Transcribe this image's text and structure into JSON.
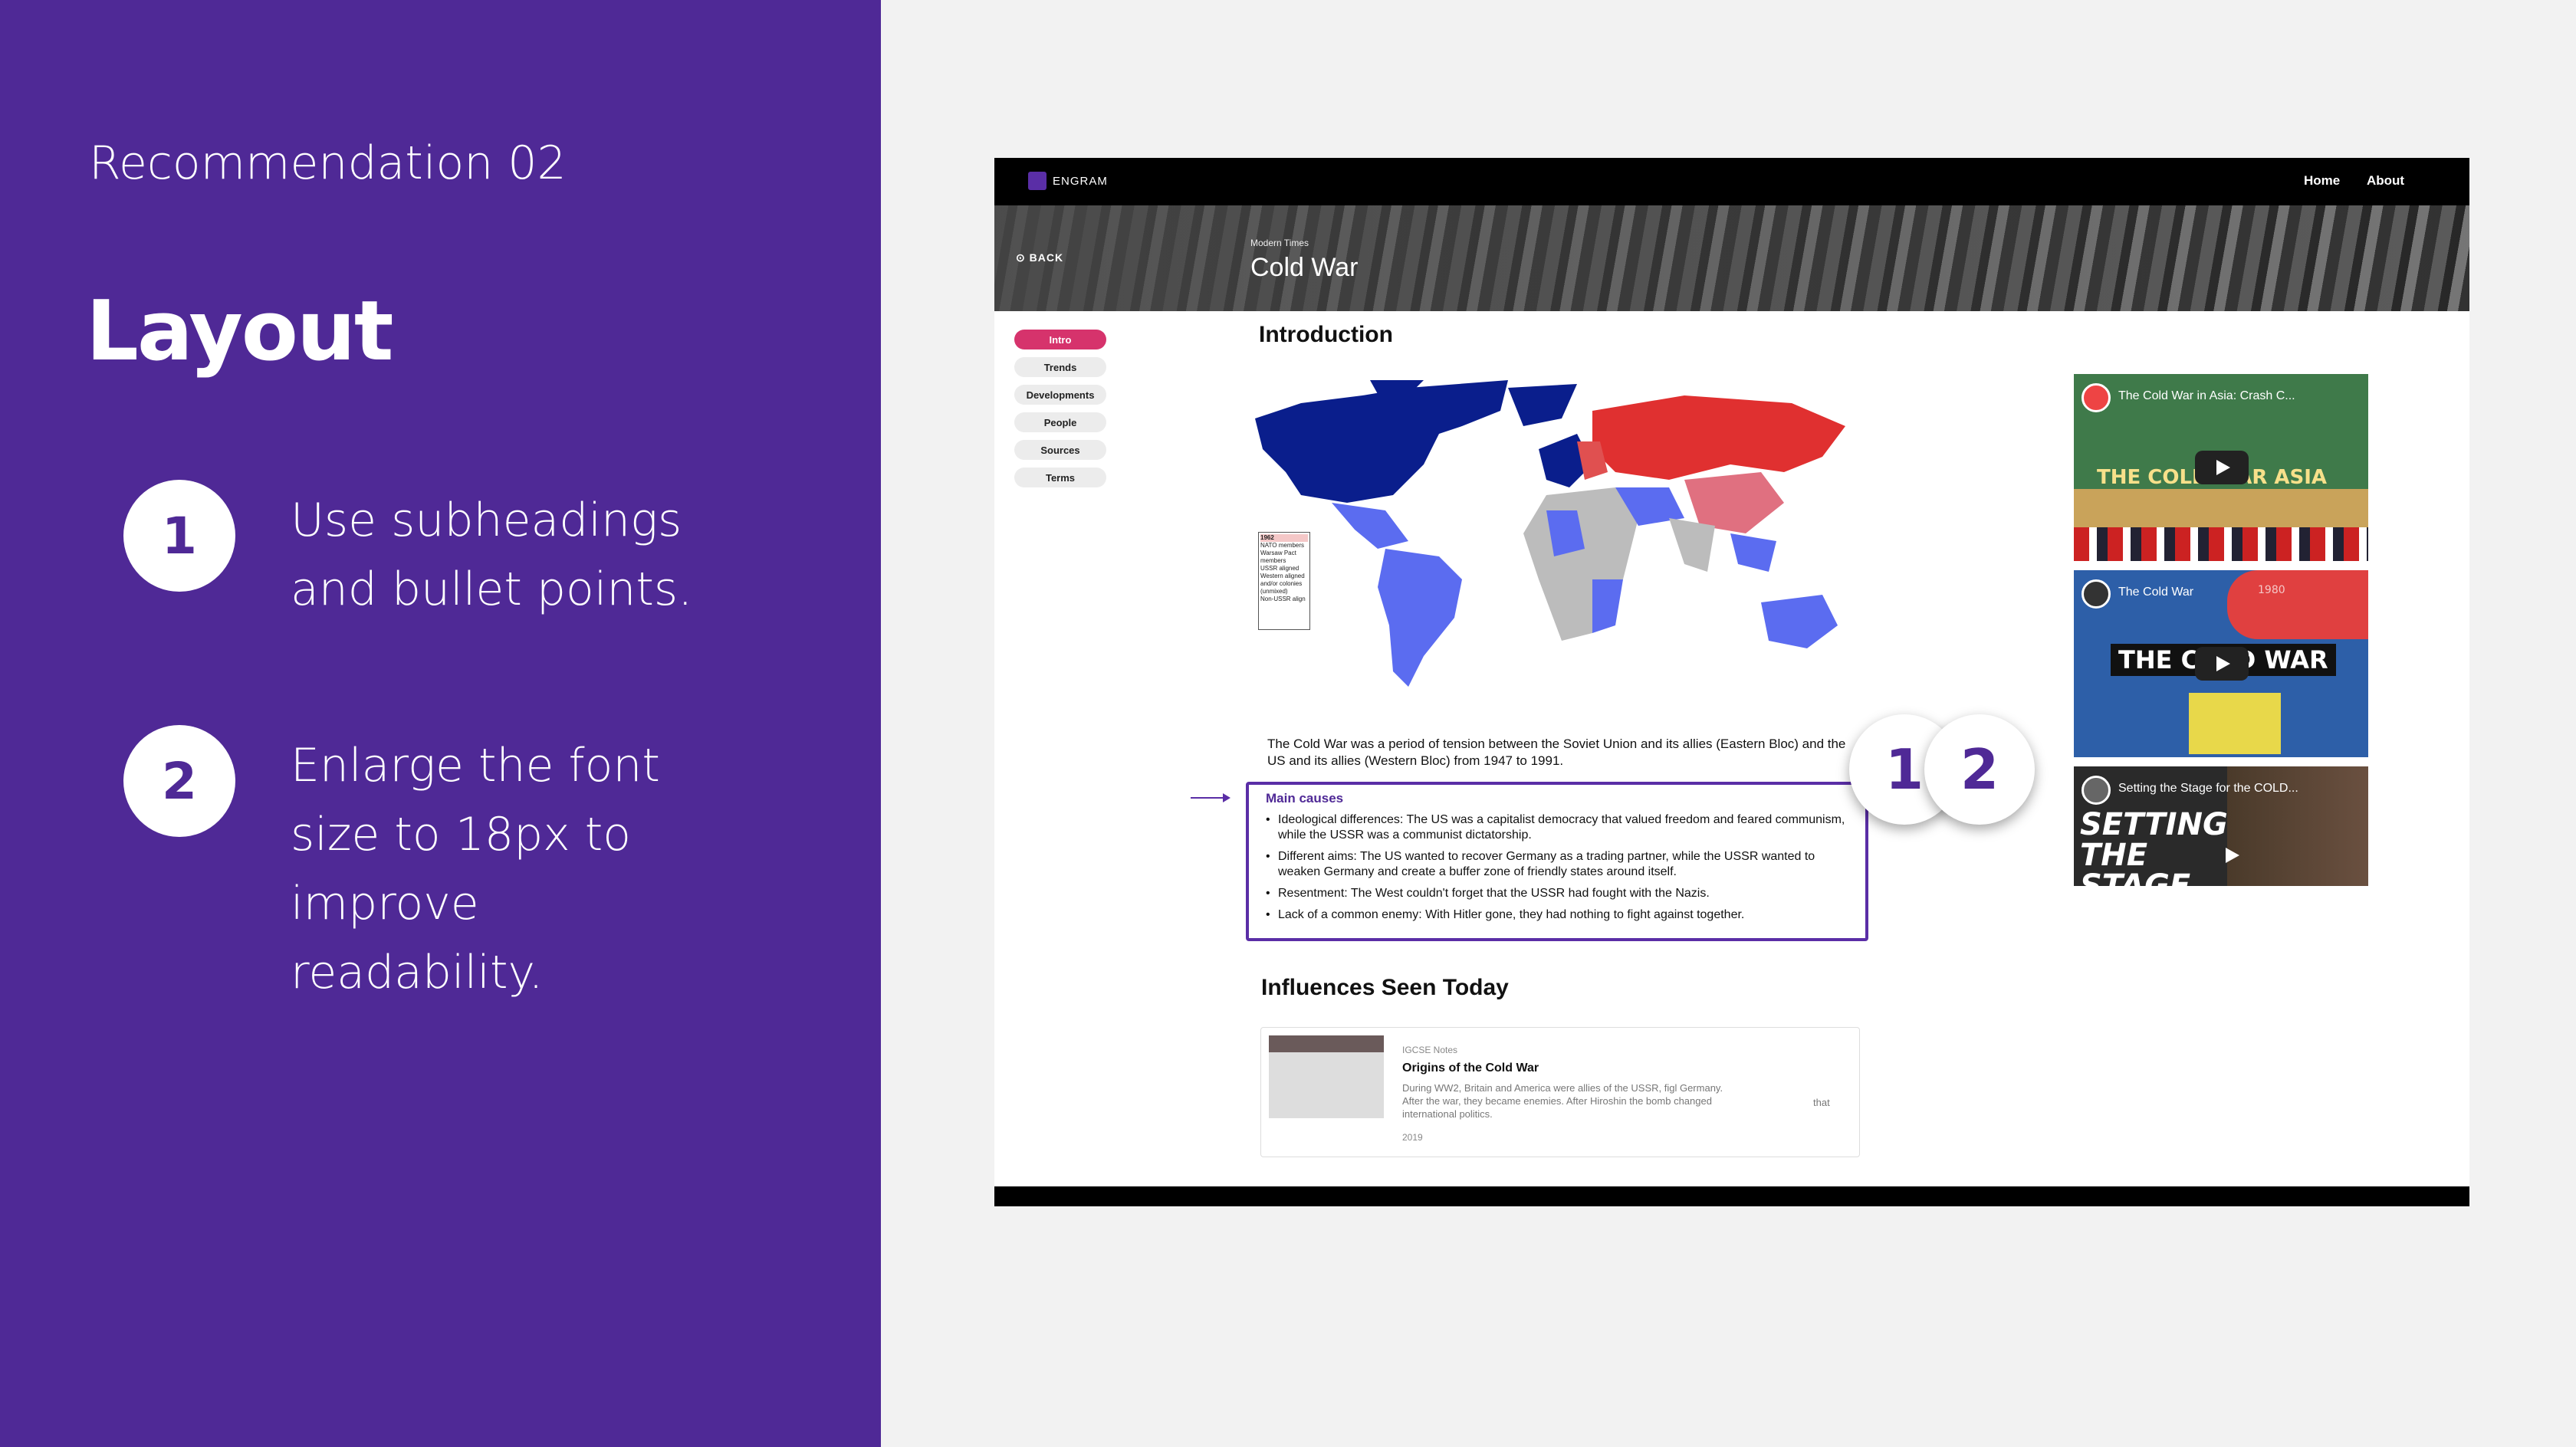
{
  "slide": {
    "recommendation_label": "Recommendation 02",
    "title": "Layout",
    "points": [
      {
        "num": "1",
        "text": "Use subheadings and bullet points."
      },
      {
        "num": "2",
        "text": "Enlarge the font size to 18px to improve readability."
      }
    ]
  },
  "site": {
    "logo_text": "ENGRAM",
    "nav": [
      "Home",
      "About"
    ],
    "back_label": "BACK",
    "hero_sub": "Modern Times",
    "hero_title": "Cold War",
    "sidebar": [
      "Intro",
      "Trends",
      "Developments",
      "People",
      "Sources",
      "Terms"
    ],
    "intro_heading": "Introduction",
    "legend": {
      "title": "1962",
      "lines": [
        "NATO members",
        "Warsaw Pact members",
        "USSR aligned",
        "Western aligned and/or colonies (unmixed)",
        "Non-USSR align"
      ]
    },
    "intro_paragraph": "The Cold War was a period of tension between the Soviet Union and its allies (Eastern Bloc) and the US and its allies (Western Bloc) from 1947 to 1991.",
    "causes": {
      "title": "Main causes",
      "items": [
        "Ideological differences: The US was a capitalist democracy that valued freedom and feared communism, while the USSR was a communist dictatorship.",
        "Different aims: The US wanted to recover Germany as a trading partner, while the USSR wanted to weaken Germany and create a buffer zone of friendly states around itself.",
        "Resentment: The West couldn't forget that the USSR had fought with the Nazis.",
        "Lack of a common enemy: With Hitler gone, they had nothing to fight against together."
      ]
    },
    "badges": [
      "1",
      "2"
    ],
    "videos": [
      {
        "title": "The Cold War in Asia: Crash C...",
        "big": "THE COLD WAR ASIA"
      },
      {
        "title": "The Cold War",
        "big": "THE COLD WAR",
        "year": "1980"
      },
      {
        "title": "Setting the Stage for the COLD...",
        "big": "SETTING THE STAGE"
      }
    ],
    "influences_heading": "Influences Seen Today",
    "card": {
      "source": "IGCSE Notes",
      "title": "Origins of the Cold War",
      "body": "During WW2, Britain and America were allies of the USSR, figl Germany. After the war, they became enemies. After Hiroshin the bomb changed international politics.",
      "extra": "that",
      "year": "2019"
    }
  },
  "colors": {
    "panel": "#4f2996",
    "accent_pink": "#d6336c",
    "nato_blue": "#0a1e8c",
    "warsaw_red": "#e03030",
    "western_aligned": "#5b6cf0"
  }
}
